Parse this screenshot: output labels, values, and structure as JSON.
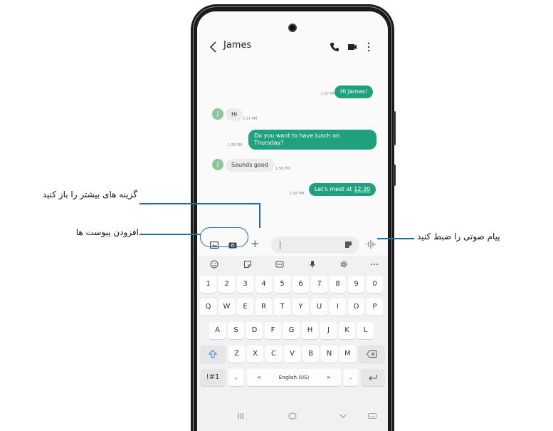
{
  "callouts": {
    "more_options": "گزینه های بیشتر را باز کنید",
    "add_attachments": "افزودن پیوست ها",
    "record_voice": "پیام صوتی را ضبط کنید"
  },
  "header": {
    "contact_name": "James"
  },
  "messages": [
    {
      "dir": "out",
      "text": "Hi James!",
      "time": "1:57 PM"
    },
    {
      "dir": "in",
      "avatar": "J",
      "text": "Hi",
      "time": "1:57 PM"
    },
    {
      "dir": "out",
      "line1": "Do you want to have lunch on",
      "line2": "Thursday?",
      "time": "1:58 PM"
    },
    {
      "dir": "in",
      "avatar": "J",
      "text": "Sounds good",
      "time": "1:58 PM"
    },
    {
      "dir": "out",
      "text": "Let's meet at",
      "link": "12:30",
      "time": "1:58 PM"
    }
  ],
  "composer": {
    "plus": "+"
  },
  "keyboard": {
    "row_numbers": [
      "1",
      "2",
      "3",
      "4",
      "5",
      "6",
      "7",
      "8",
      "9",
      "0"
    ],
    "row_q": [
      "Q",
      "W",
      "E",
      "R",
      "T",
      "Y",
      "U",
      "I",
      "O",
      "P"
    ],
    "row_a": [
      "A",
      "S",
      "D",
      "F",
      "G",
      "H",
      "J",
      "K",
      "L"
    ],
    "row_z": [
      "Z",
      "X",
      "C",
      "V",
      "B",
      "N",
      "M"
    ],
    "sym_key": "!#1",
    "comma": ",",
    "lang_prev": "<",
    "language": "English (US)",
    "lang_next": ">",
    "period": "."
  },
  "colors": {
    "accent": "#1fa180",
    "callout_line": "#1f6fa3"
  }
}
